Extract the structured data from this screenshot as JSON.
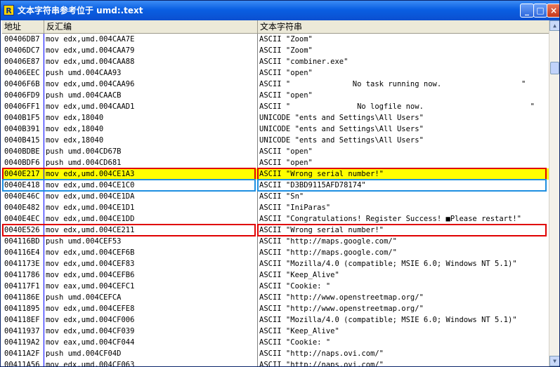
{
  "window": {
    "title": "文本字符串参考位于 umd:.text",
    "icon_letter": "R",
    "buttons": {
      "minimize": "_",
      "maximize": "□",
      "close": "×"
    }
  },
  "columns": {
    "address": "地址",
    "disassembly": "反汇编",
    "text": "文本字符串"
  },
  "rows": [
    {
      "addr": "00406DB7",
      "asm": "mov edx,umd.004CAA7E",
      "text": "ASCII \"Zoom\""
    },
    {
      "addr": "00406DC7",
      "asm": "mov edx,umd.004CAA79",
      "text": "ASCII \"Zoom\""
    },
    {
      "addr": "00406E87",
      "asm": "mov edx,umd.004CAA88",
      "text": "ASCII \"combiner.exe\""
    },
    {
      "addr": "00406EEC",
      "asm": "push umd.004CAA93",
      "text": "ASCII \"open\""
    },
    {
      "addr": "00406F6B",
      "asm": "mov edx,umd.004CAA96",
      "text": "ASCII \"              No task running now.                  \""
    },
    {
      "addr": "00406FD9",
      "asm": "push umd.004CAACB",
      "text": "ASCII \"open\""
    },
    {
      "addr": "00406FF1",
      "asm": "mov edx,umd.004CAAD1",
      "text": "ASCII \"               No logfile now.                        \""
    },
    {
      "addr": "0040B1F5",
      "asm": "mov edx,18040",
      "text": "UNICODE \"ents and Settings\\All Users\""
    },
    {
      "addr": "0040B391",
      "asm": "mov edx,18040",
      "text": "UNICODE \"ents and Settings\\All Users\""
    },
    {
      "addr": "0040B415",
      "asm": "mov edx,18040",
      "text": "UNICODE \"ents and Settings\\All Users\""
    },
    {
      "addr": "0040BDBE",
      "asm": "push umd.004CD67B",
      "text": "ASCII \"open\""
    },
    {
      "addr": "0040BDF6",
      "asm": "push umd.004CD681",
      "text": "ASCII \"open\""
    },
    {
      "addr": "0040E217",
      "asm": "mov edx,umd.004CE1A3",
      "text": "ASCII \"Wrong serial number!\""
    },
    {
      "addr": "0040E418",
      "asm": "mov edx,umd.004CE1C0",
      "text": "ASCII \"D3BD9115AFD78174\""
    },
    {
      "addr": "0040E46C",
      "asm": "mov edx,umd.004CE1DA",
      "text": "ASCII \"Sn\""
    },
    {
      "addr": "0040E482",
      "asm": "mov edx,umd.004CE1D1",
      "text": "ASCII \"IniParas\""
    },
    {
      "addr": "0040E4EC",
      "asm": "mov edx,umd.004CE1DD",
      "text": "ASCII \"Congratulations! Register Success! ■Please restart!\""
    },
    {
      "addr": "0040E526",
      "asm": "mov edx,umd.004CE211",
      "text": "ASCII \"Wrong serial number!\""
    },
    {
      "addr": "004116BD",
      "asm": "push umd.004CEF53",
      "text": "ASCII \"http://maps.google.com/\""
    },
    {
      "addr": "004116E4",
      "asm": "mov edx,umd.004CEF6B",
      "text": "ASCII \"http://maps.google.com/\""
    },
    {
      "addr": "0041173E",
      "asm": "mov edx,umd.004CEF83",
      "text": "ASCII \"Mozilla/4.0 (compatible; MSIE 6.0; Windows NT 5.1)\""
    },
    {
      "addr": "00411786",
      "asm": "mov edx,umd.004CEFB6",
      "text": "ASCII \"Keep_Alive\""
    },
    {
      "addr": "004117F1",
      "asm": "mov eax,umd.004CEFC1",
      "text": "ASCII \"Cookie: \""
    },
    {
      "addr": "0041186E",
      "asm": "push umd.004CEFCA",
      "text": "ASCII \"http://www.openstreetmap.org/\""
    },
    {
      "addr": "00411895",
      "asm": "mov edx,umd.004CEFE8",
      "text": "ASCII \"http://www.openstreetmap.org/\""
    },
    {
      "addr": "004118EF",
      "asm": "mov edx,umd.004CF006",
      "text": "ASCII \"Mozilla/4.0 (compatible; MSIE 6.0; Windows NT 5.1)\""
    },
    {
      "addr": "00411937",
      "asm": "mov edx,umd.004CF039",
      "text": "ASCII \"Keep_Alive\""
    },
    {
      "addr": "004119A2",
      "asm": "mov eax,umd.004CF044",
      "text": "ASCII \"Cookie: \""
    },
    {
      "addr": "00411A2F",
      "asm": "push umd.004CF04D",
      "text": "ASCII \"http://naps.ovi.com/\""
    },
    {
      "addr": "00411A56",
      "asm": "mov edx,umd.004CF063",
      "text": "ASCII \"http://naps.ovi.com/\""
    }
  ],
  "selected_row": 12,
  "annotations": [
    {
      "row": 12,
      "color": "red"
    },
    {
      "row": 13,
      "color": "blue"
    },
    {
      "row": 17,
      "color": "red"
    }
  ],
  "colors": {
    "titlebar": "#0a5fe2",
    "selection": "#ffff00",
    "address_text": "#000000",
    "divider": "#0000ff"
  }
}
